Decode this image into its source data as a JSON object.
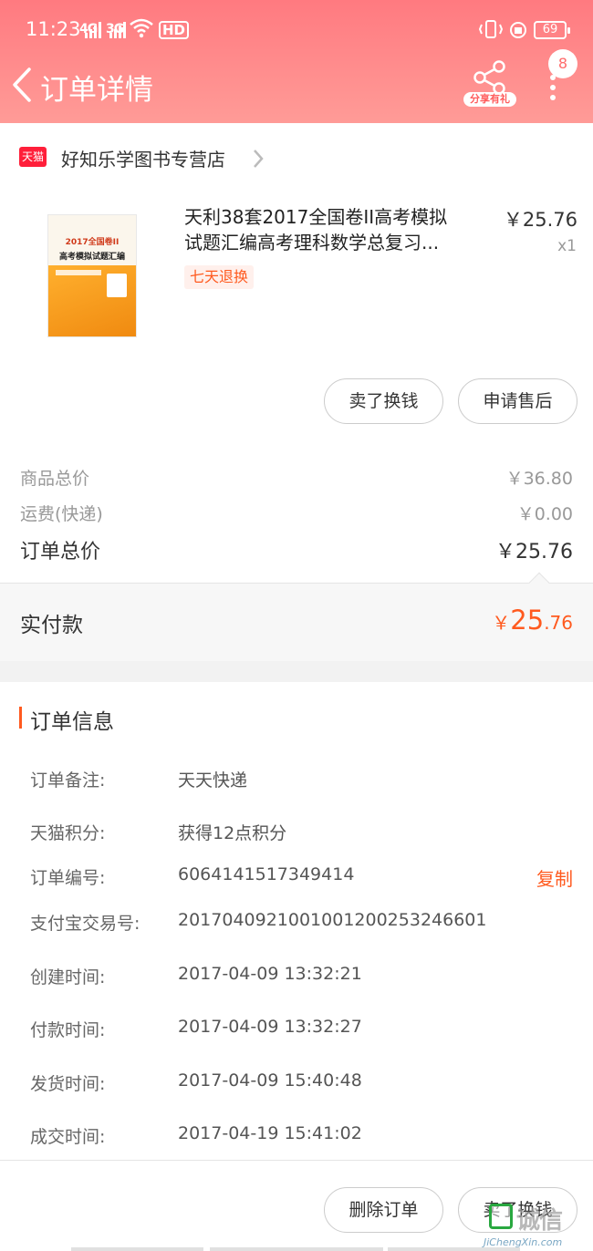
{
  "status_bar": {
    "time": "11:23",
    "net1": "4G",
    "net2": "3G",
    "hd": "HD",
    "battery": "69"
  },
  "nav": {
    "title": "订单详情",
    "share_label": "分享有礼",
    "badge_count": "8"
  },
  "store": {
    "badge": "天猫",
    "name": "好知乐学图书专营店"
  },
  "product": {
    "title_line1": "天利38套2017全国卷II高考模拟",
    "title_line2": "试题汇编高考理科数学总复习...",
    "price": "￥25.76",
    "qty": "x1",
    "tag": "七天退换",
    "cover_title": "2017全国卷II",
    "cover_subtitle": "高考模拟试题汇编"
  },
  "actions": {
    "sell": "卖了换钱",
    "after_sale": "申请售后"
  },
  "fees": {
    "goods_label": "商品总价",
    "goods_value": "￥36.80",
    "shipping_label": "运费(快递)",
    "shipping_value": "￥0.00",
    "total_label": "订单总价",
    "total_value": "￥25.76"
  },
  "paid": {
    "label": "实付款",
    "currency": "￥",
    "integer": "25",
    "decimal": ".76"
  },
  "order_info": {
    "title": "订单信息",
    "rows": [
      {
        "key": "订单备注:",
        "value": "天天快递"
      },
      {
        "key": "天猫积分:",
        "value": "获得12点积分"
      },
      {
        "key": "订单编号:",
        "value": "6064141517349414"
      },
      {
        "key": "支付宝交易号:",
        "value": "2017040921001001200253246601"
      },
      {
        "key": "创建时间:",
        "value": "2017-04-09 13:32:21"
      },
      {
        "key": "付款时间:",
        "value": "2017-04-09 13:32:27"
      },
      {
        "key": "发货时间:",
        "value": "2017-04-09 15:40:48"
      },
      {
        "key": "成交时间:",
        "value": "2017-04-19 15:41:02"
      }
    ],
    "copy_label": "复制"
  },
  "bottom_bar": {
    "delete": "删除订单",
    "sell": "卖了换钱"
  },
  "watermark": {
    "text": "诚信",
    "sub": "JiChengXin.com"
  },
  "colors": {
    "header_gradient_top": "#ff7a80",
    "accent_orange": "#ff5a1f",
    "tmall_red": "#ff1f3a"
  }
}
